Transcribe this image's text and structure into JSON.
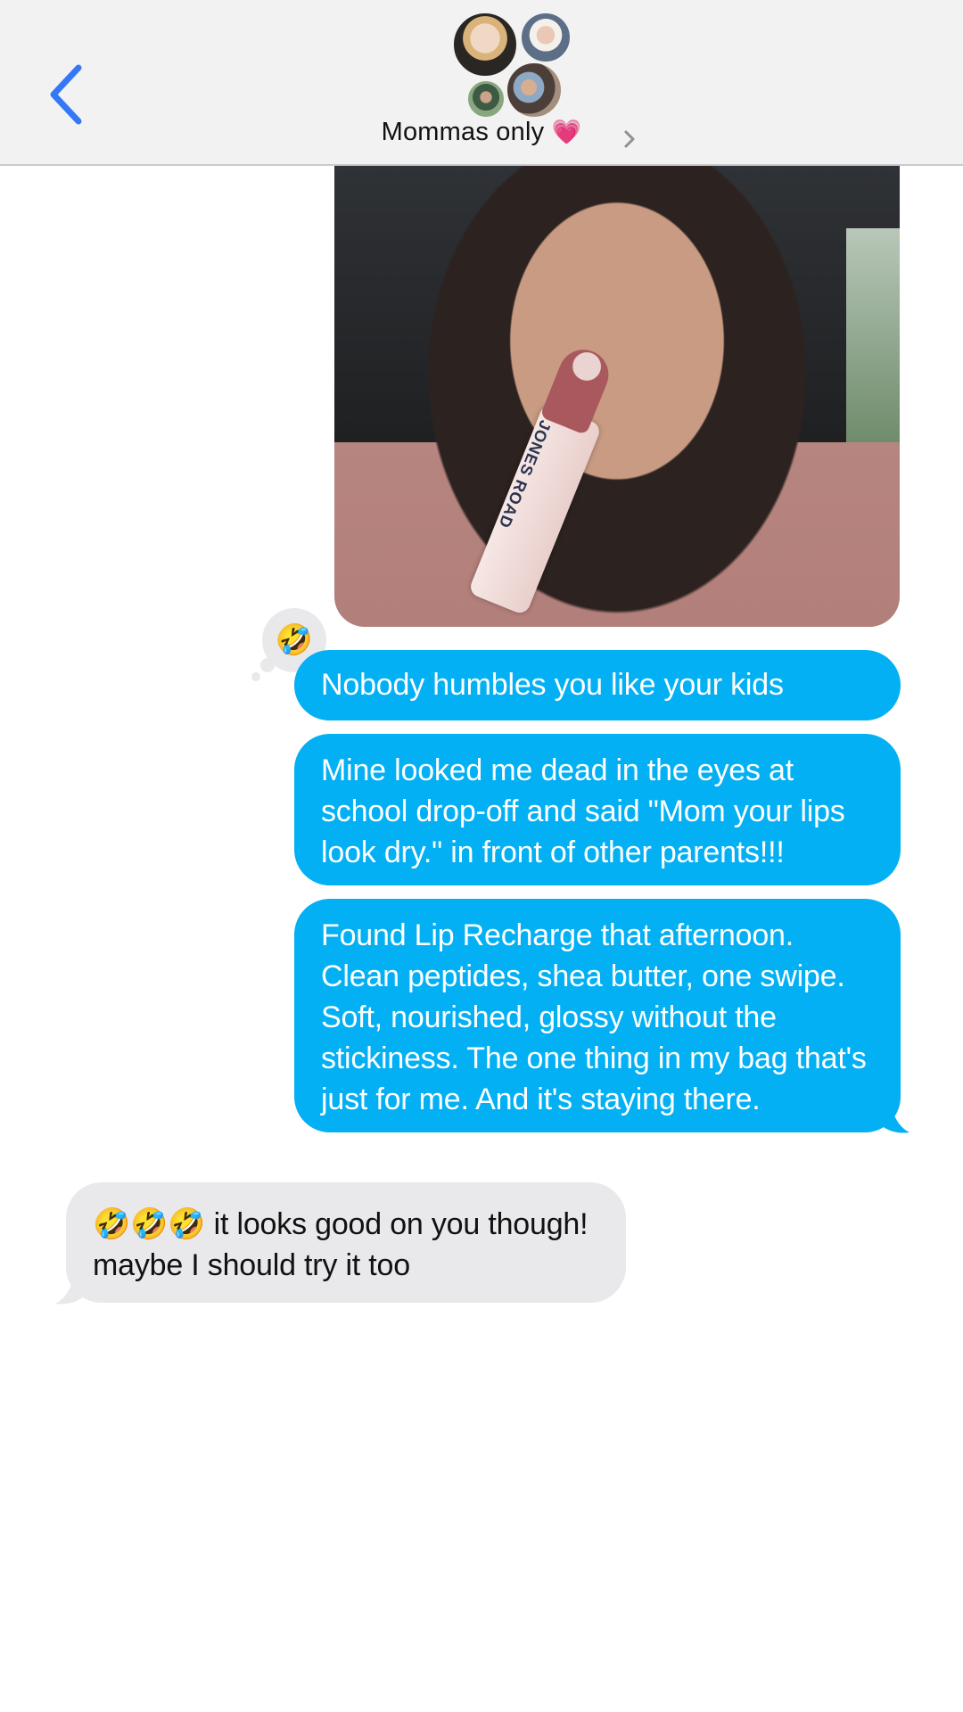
{
  "header": {
    "back_icon": "chevron-left-icon",
    "group_name": "Mommas only",
    "group_emoji": "💗",
    "chevron_icon": "chevron-right-icon",
    "avatars": [
      "member-avatar-1",
      "member-avatar-2",
      "member-avatar-3",
      "member-avatar-4"
    ]
  },
  "photo": {
    "product_text": "JONES ROAD"
  },
  "tapback": {
    "emoji": "🤣"
  },
  "messages": [
    {
      "from": "me",
      "text": "Nobody humbles you like your kids"
    },
    {
      "from": "me",
      "text": "Mine looked me dead in the eyes at school drop-off and said \"Mom your lips look dry.\" in front of other parents!!!"
    },
    {
      "from": "me",
      "text": "Found Lip Recharge that afternoon. Clean peptides, shea butter, one swipe. Soft, nourished, glossy without the stickiness. The one thing in my bag that's just for me. And it's staying there."
    },
    {
      "from": "them",
      "text": "🤣🤣🤣 it looks good on you though! maybe I should try it too"
    }
  ],
  "colors": {
    "outgoing_bubble": "#03b0f4",
    "incoming_bubble": "#e9e9eb",
    "accent": "#3478f6",
    "header_bg": "#f2f2f3"
  }
}
